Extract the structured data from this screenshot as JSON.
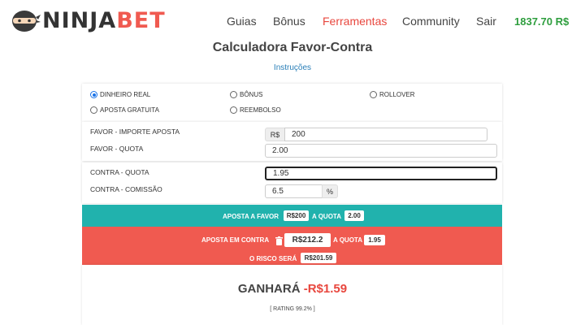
{
  "header": {
    "logo": {
      "part1": "NINJA",
      "part2": "BET"
    },
    "nav": [
      {
        "label": "Guias"
      },
      {
        "label": "Bônus"
      },
      {
        "label": "Ferramentas"
      },
      {
        "label": "Community"
      },
      {
        "label": "Sair"
      }
    ],
    "balance": "1837.70 R$"
  },
  "page": {
    "title": "Calculadora Favor-Contra",
    "instructions_link": "Instruções"
  },
  "options": {
    "dinheiro_real": "DINHEIRO REAL",
    "bonus": "BÔNUS",
    "rollover": "ROLLOVER",
    "aposta_gratuita": "APOSTA GRATUITA",
    "reembolso": "REEMBOLSO",
    "selected": "DINHEIRO REAL"
  },
  "favor": {
    "stake_label": "FAVOR - IMPORTE APOSTA",
    "currency_prefix": "R$",
    "stake_value": "200",
    "odds_label": "FAVOR - QUOTA",
    "odds_value": "2.00"
  },
  "contra": {
    "odds_label": "CONTRA - QUOTA",
    "odds_value": "1.95",
    "commission_label": "CONTRA - COMISSÃO",
    "commission_value": "6.5",
    "commission_suffix": "%"
  },
  "results": {
    "favor_text": "APOSTA A FAVOR",
    "favor_amount": "R$200",
    "favor_at_odds": "A QUOTA",
    "favor_odds": "2.00",
    "contra_text": "APOSTA EM CONTRA",
    "contra_amount": "R$212.2",
    "contra_at_odds": "A QUOTA",
    "contra_odds": "1.95",
    "risk_text": "O RISCO SERÁ",
    "risk_amount": "R$201.59"
  },
  "outcome": {
    "label": "GANHARÁ",
    "value": "-R$1.59",
    "rating": "[ RATING 99.2% ]"
  },
  "colors": {
    "accent_red": "#f05a50",
    "teal": "#21b2ad",
    "balance_green": "#2e9e3e"
  }
}
